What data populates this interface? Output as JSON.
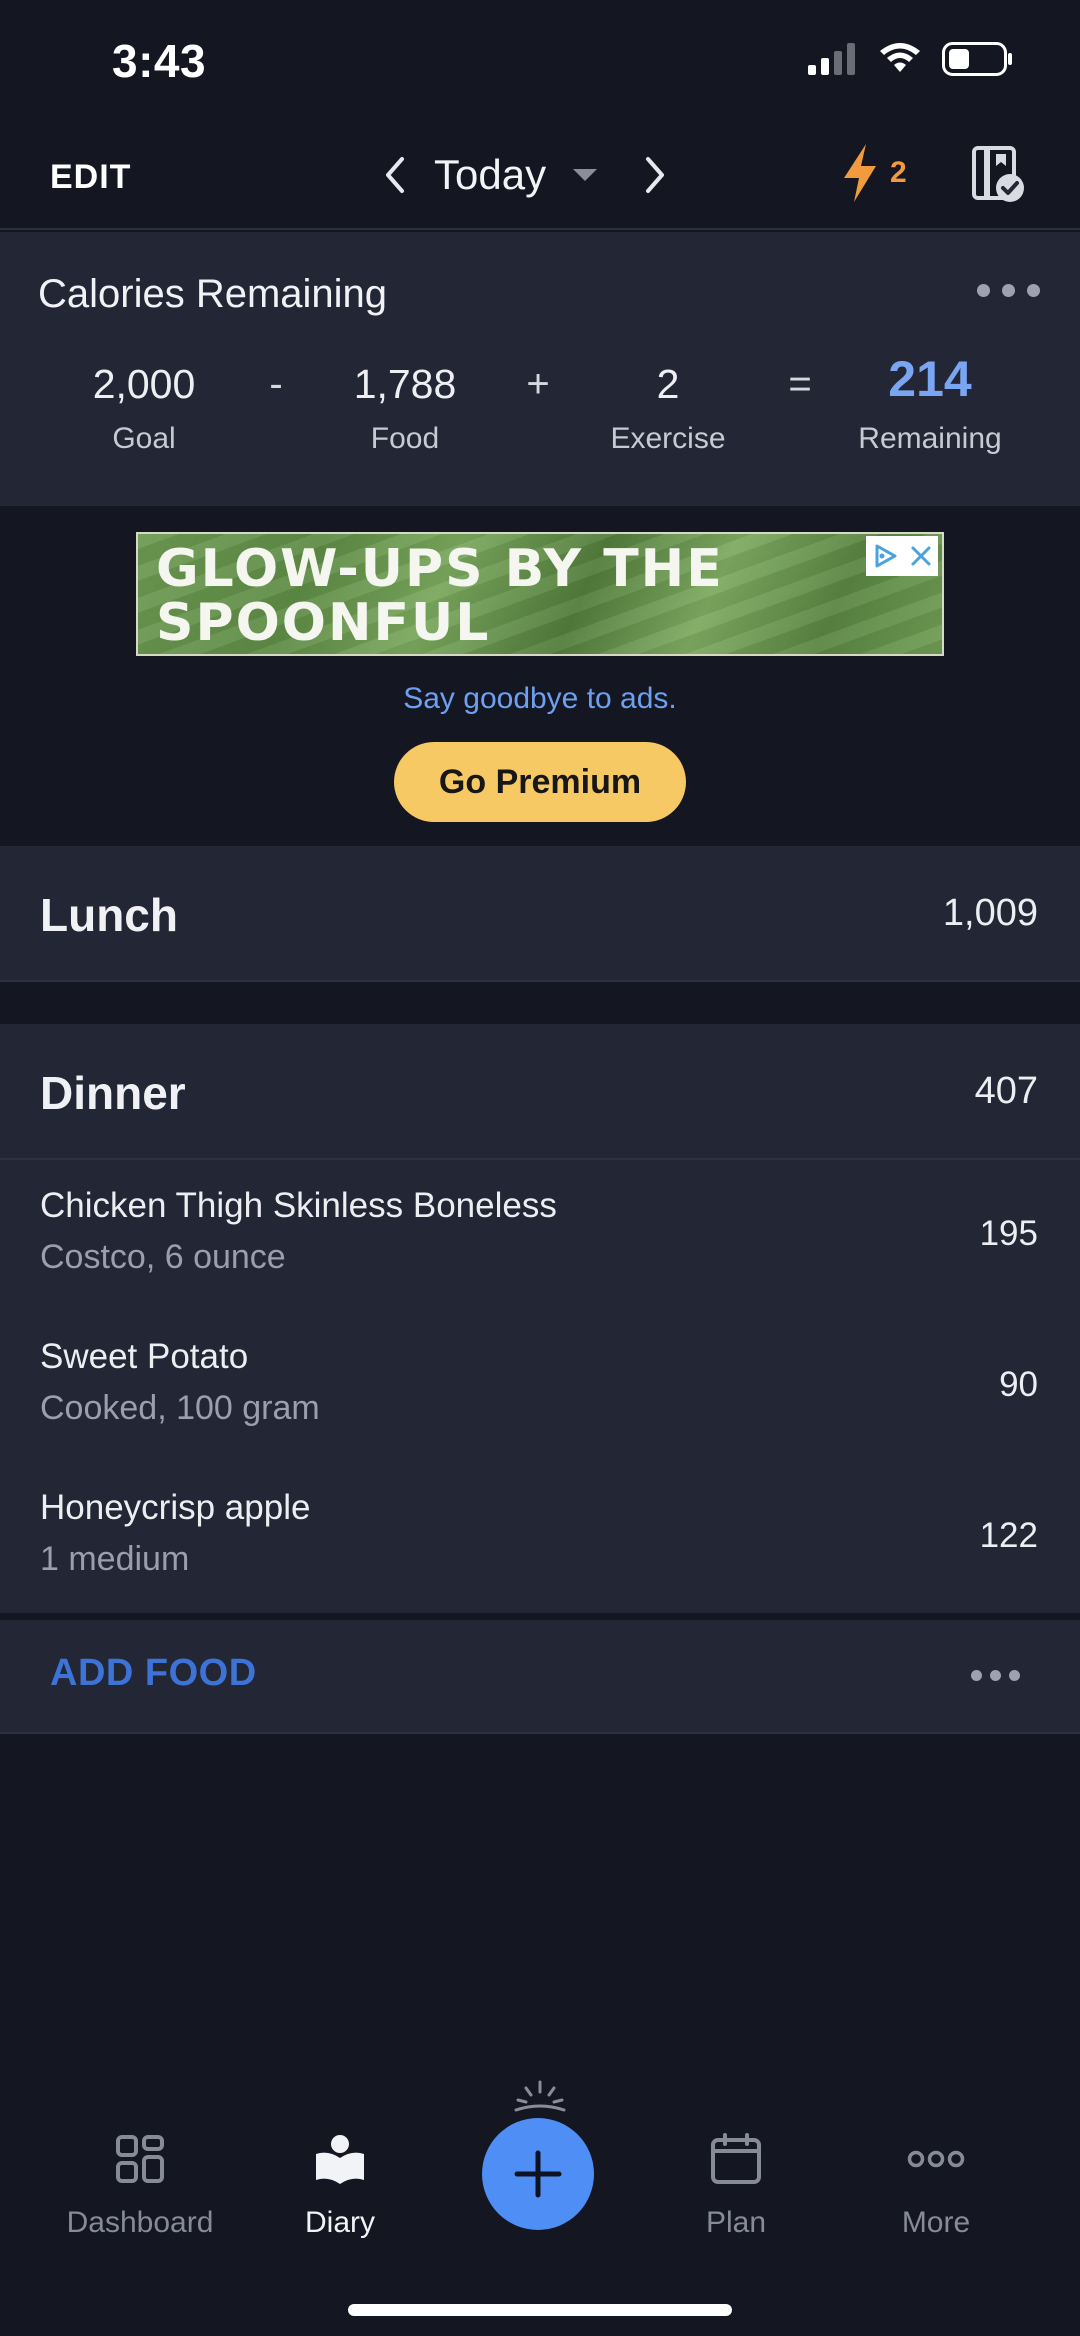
{
  "status_bar": {
    "time": "3:43"
  },
  "top_nav": {
    "edit_label": "EDIT",
    "date_label": "Today",
    "streak_count": "2"
  },
  "calories": {
    "title": "Calories Remaining",
    "goal_value": "2,000",
    "goal_label": "Goal",
    "minus_op": "-",
    "food_value": "1,788",
    "food_label": "Food",
    "plus_op": "+",
    "exercise_value": "2",
    "exercise_label": "Exercise",
    "equals_op": "=",
    "remaining_value": "214",
    "remaining_label": "Remaining"
  },
  "ad": {
    "banner_line1": "GLOW-UPS BY THE",
    "banner_line2": "SPOONFUL",
    "cta_text": "Say goodbye to ads.",
    "premium_label": "Go Premium"
  },
  "meals": {
    "lunch": {
      "name": "Lunch",
      "total": "1,009"
    },
    "dinner": {
      "name": "Dinner",
      "total": "407",
      "items": [
        {
          "name": "Chicken Thigh Skinless Boneless",
          "desc": "Costco, 6 ounce",
          "cal": "195"
        },
        {
          "name": "Sweet Potato",
          "desc": "Cooked, 100 gram",
          "cal": "90"
        },
        {
          "name": "Honeycrisp apple",
          "desc": "1 medium",
          "cal": "122"
        }
      ],
      "add_food_label": "ADD FOOD"
    }
  },
  "tabs": {
    "dashboard": "Dashboard",
    "diary": "Diary",
    "plan": "Plan",
    "more": "More"
  },
  "colors": {
    "accent_blue": "#4f8ef5",
    "remaining_blue": "#7aa5f2",
    "streak_orange": "#f19a3e",
    "premium_yellow": "#f7c965"
  }
}
